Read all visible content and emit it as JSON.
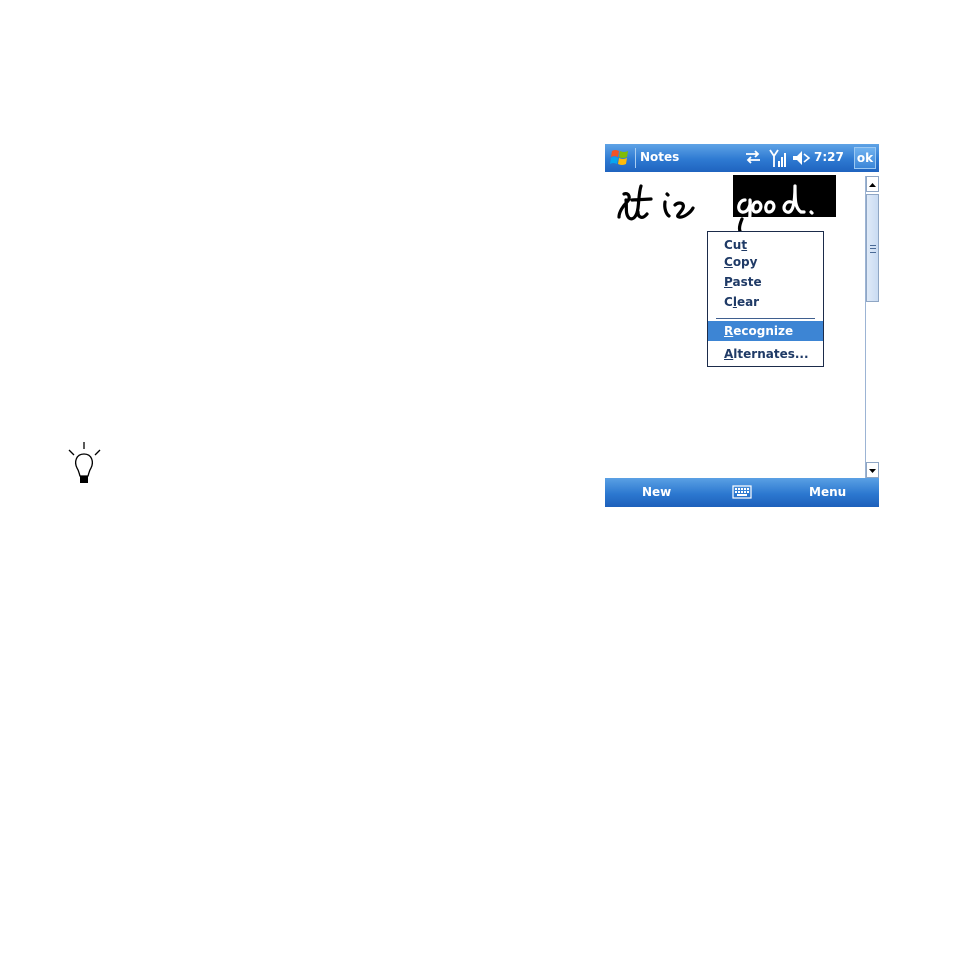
{
  "window": {
    "title": "Notes",
    "ok_label": "ok",
    "clock": "7:27"
  },
  "status_icons": [
    "connectivity-icon",
    "signal-icon",
    "speaker-muted-icon"
  ],
  "note": {
    "handwriting": "It is good."
  },
  "context_menu": {
    "items": [
      {
        "pre": "Cu",
        "acc": "t",
        "post": ""
      },
      {
        "pre": "",
        "acc": "C",
        "post": "opy"
      },
      {
        "pre": "",
        "acc": "P",
        "post": "aste"
      },
      {
        "pre": "C",
        "acc": "l",
        "post": "ear"
      },
      {
        "pre": "",
        "acc": "R",
        "post": "ecognize"
      },
      {
        "pre": "",
        "acc": "A",
        "post": "lternates..."
      }
    ],
    "selected_index": 4
  },
  "menubar": {
    "left": "New",
    "right": "Menu"
  },
  "colors": {
    "titlebar": "#2e7ad2",
    "selection": "#3d85d4",
    "menu_text": "#1f3a66"
  }
}
